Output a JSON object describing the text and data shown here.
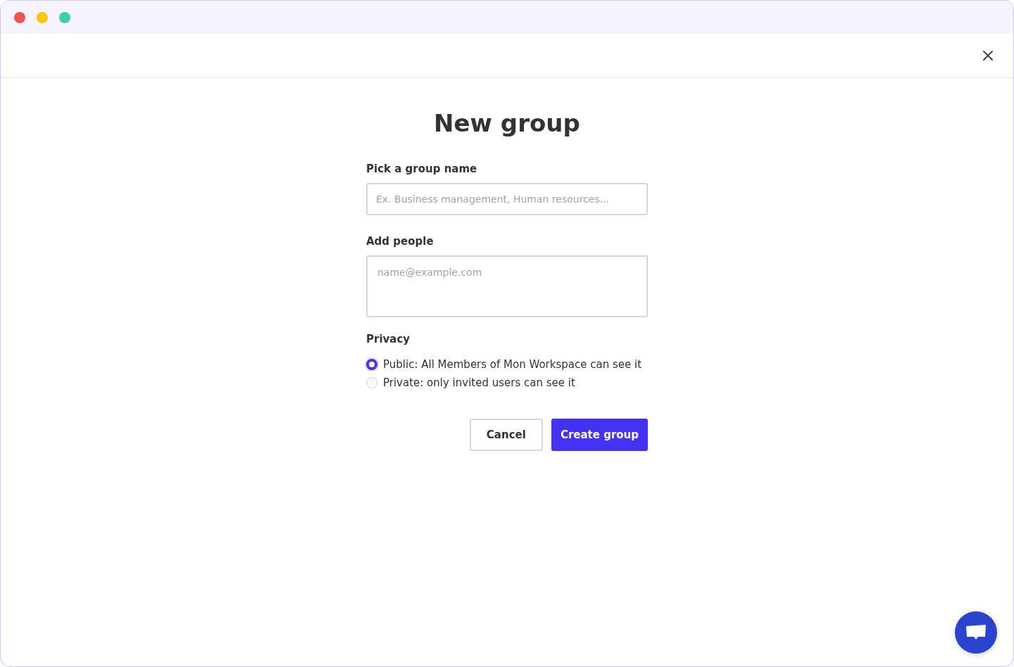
{
  "dialog": {
    "title": "New group"
  },
  "group_name": {
    "label": "Pick a group name",
    "placeholder": "Ex. Business management, Human resources..."
  },
  "people": {
    "label": "Add people",
    "placeholder": "name@example.com"
  },
  "privacy": {
    "label": "Privacy",
    "options": [
      {
        "label": "Public: All Members of Mon Workspace can see it",
        "selected": true
      },
      {
        "label": "Private: only invited users can see it",
        "selected": false
      }
    ]
  },
  "buttons": [
    {
      "label": "Cancel",
      "kind": "secondary"
    },
    {
      "label": "Create group",
      "kind": "primary"
    }
  ]
}
